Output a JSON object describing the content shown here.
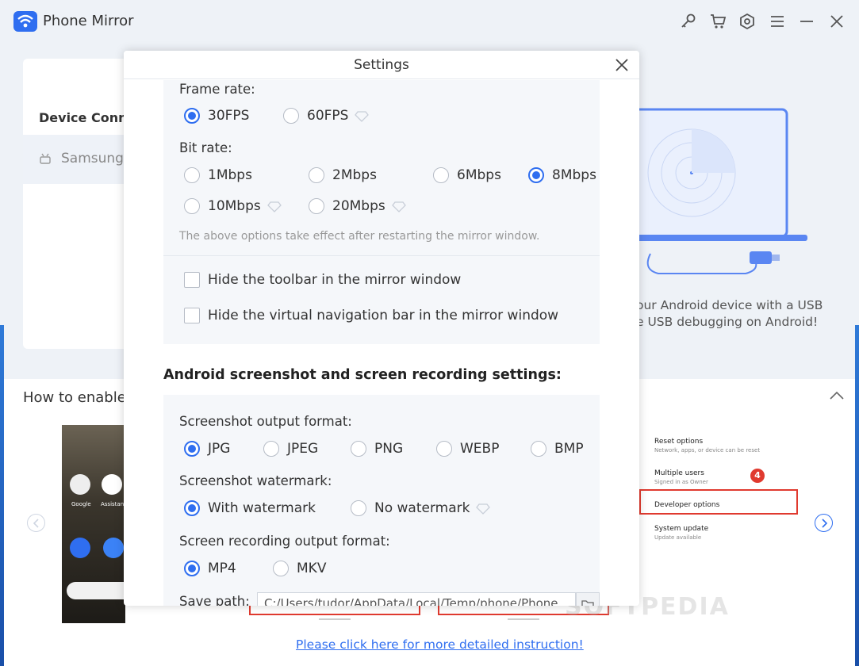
{
  "app": {
    "title": "Phone Mirror"
  },
  "titlebar": {
    "icons": [
      "key-icon",
      "cart-icon",
      "settings-gear-icon",
      "menu-icon",
      "minimize-icon",
      "close-icon"
    ]
  },
  "left_panel": {
    "section_title": "Device Conne",
    "device_name": "Samsung"
  },
  "right_panel": {
    "usb_line1": "our Android device with a USB",
    "usb_line2": "e USB debugging on Android!"
  },
  "bottom": {
    "howto_label": "How to enable",
    "instruction_link": "Please click here for more detailed instruction!",
    "phone_apps": {
      "google": "Google",
      "assistant": "Assistan"
    },
    "settings_shot": {
      "reset": "Reset options",
      "reset_sub": "Network, apps, or device can be reset",
      "multi": "Multiple users",
      "multi_sub": "Signed in as Owner",
      "dev": "Developer options",
      "sys": "System update",
      "sys_sub": "Update available",
      "badge": "4"
    },
    "watermark": "SOFTPEDIA"
  },
  "dialog": {
    "title": "Settings",
    "frame_rate": {
      "label": "Frame rate:",
      "options": [
        "30FPS",
        "60FPS"
      ],
      "selected": "30FPS"
    },
    "bit_rate": {
      "label": "Bit rate:",
      "options": [
        "1Mbps",
        "2Mbps",
        "6Mbps",
        "8Mbps",
        "10Mbps",
        "20Mbps"
      ],
      "selected": "8Mbps"
    },
    "restart_note": "The above options take effect after restarting the mirror window.",
    "hide_toolbar": "Hide the toolbar in the mirror window",
    "hide_navbar": "Hide the virtual navigation bar in the mirror window",
    "android_heading": "Android screenshot and screen recording settings:",
    "screenshot_format": {
      "label": "Screenshot output format:",
      "options": [
        "JPG",
        "JPEG",
        "PNG",
        "WEBP",
        "BMP"
      ],
      "selected": "JPG"
    },
    "watermark": {
      "label": "Screenshot watermark:",
      "options": [
        "With watermark",
        "No watermark"
      ],
      "selected": "With watermark"
    },
    "recording_format": {
      "label": "Screen recording output format:",
      "options": [
        "MP4",
        "MKV"
      ],
      "selected": "MP4"
    },
    "save_path": {
      "label": "Save path:",
      "value": "C:/Users/tudor/AppData/Local/Temp/phone/Phone"
    }
  },
  "colors": {
    "accent": "#2f6ef0",
    "highlight_red": "#e03a2f"
  }
}
